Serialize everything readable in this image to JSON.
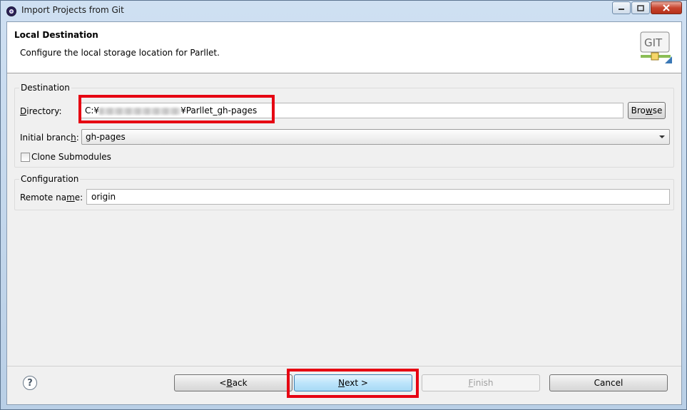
{
  "window": {
    "title": "Import Projects from Git"
  },
  "header": {
    "title": "Local Destination",
    "description": "Configure the local storage location for Parllet.",
    "logo_text": "GIT"
  },
  "destination": {
    "group_label": "Destination",
    "directory_label_prefix": "D",
    "directory_label_rest": "irectory:",
    "directory_value_prefix": "C:¥",
    "directory_value_suffix": "¥Parllet_gh-pages",
    "browse_label_pre": "Bro",
    "browse_label_mn": "w",
    "browse_label_post": "se",
    "initial_branch_label_pre": "Initial branc",
    "initial_branch_label_mn": "h",
    "initial_branch_label_post": ":",
    "initial_branch_value": "gh-pages",
    "clone_submodules_label": "Clone Submodules",
    "clone_submodules_checked": false
  },
  "configuration": {
    "group_label": "Configuration",
    "remote_name_label_pre": "Remote na",
    "remote_name_label_mn": "m",
    "remote_name_label_post": "e:",
    "remote_name_value": "origin"
  },
  "footer": {
    "help_symbol": "?",
    "back_pre": "< ",
    "back_mn": "B",
    "back_post": "ack",
    "next_mn": "N",
    "next_post": "ext >",
    "finish_mn": "F",
    "finish_post": "inish",
    "cancel_label": "Cancel"
  },
  "icons": [
    "app-icon",
    "minimize-icon",
    "maximize-icon",
    "close-icon",
    "git-logo-icon",
    "chevron-down-icon",
    "help-icon"
  ],
  "colors": {
    "highlight": "#e60012",
    "accent": "#3c7fb1"
  }
}
